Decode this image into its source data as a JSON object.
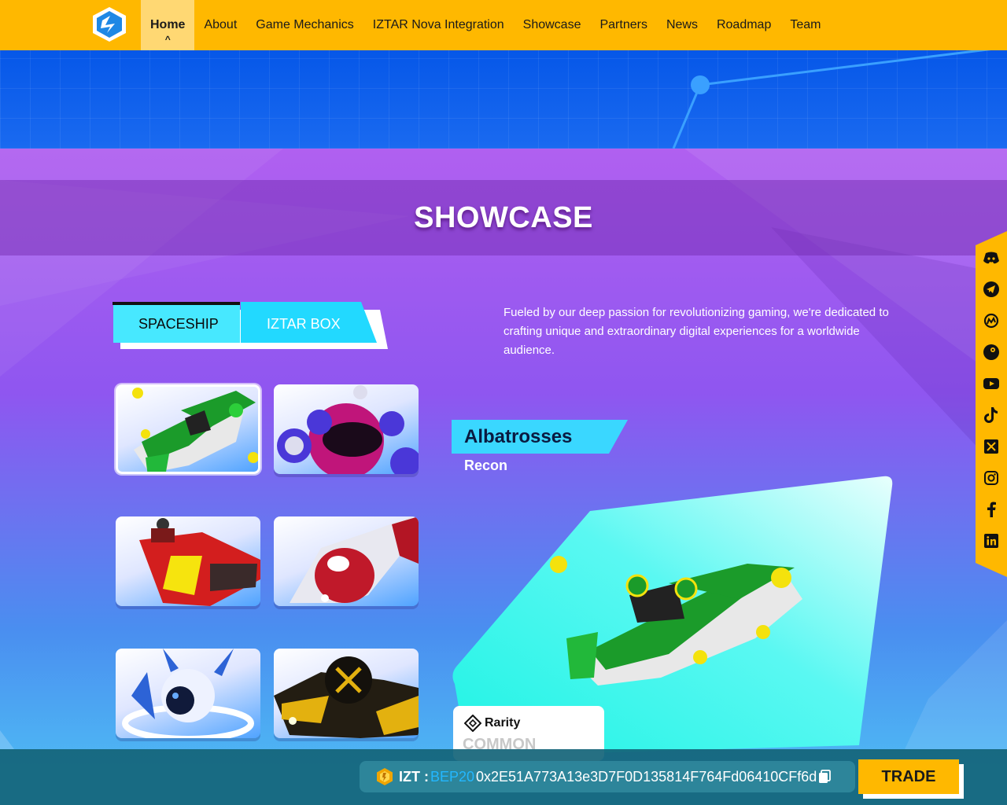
{
  "nav": {
    "logo_icon": "iztar-logo-icon",
    "items": [
      {
        "label": "Home",
        "active": true
      },
      {
        "label": "About"
      },
      {
        "label": "Game Mechanics"
      },
      {
        "label": "IZTAR Nova Integration"
      },
      {
        "label": "Showcase"
      },
      {
        "label": "Partners"
      },
      {
        "label": "News"
      },
      {
        "label": "Roadmap"
      },
      {
        "label": "Team"
      }
    ]
  },
  "page": {
    "title": "SHOWCASE"
  },
  "tabs": [
    {
      "label": "SPACESHIP",
      "active": true
    },
    {
      "label": "IZTAR BOX",
      "active": false
    }
  ],
  "description": "Fueled by our deep passion for revolutionizing gaming, we're dedicated to crafting unique and extraordinary digital experiences for a worldwide audience.",
  "grid": [
    {
      "icon": "green-spaceship-icon",
      "selected": true
    },
    {
      "icon": "pink-pod-spaceship-icon",
      "selected": false
    },
    {
      "icon": "red-yellow-spaceship-icon",
      "selected": false
    },
    {
      "icon": "red-white-spaceship-icon",
      "selected": false
    },
    {
      "icon": "white-orb-spaceship-icon",
      "selected": false
    },
    {
      "icon": "black-gold-spaceship-icon",
      "selected": false
    }
  ],
  "detail": {
    "name": "Albatrosses",
    "class": "Recon",
    "rarity_label": "Rarity",
    "rarity_value": "COMMON",
    "image_icon": "green-spaceship-icon"
  },
  "social": [
    "discord-icon",
    "telegram-icon",
    "coinmarketcap-icon",
    "coingecko-icon",
    "youtube-icon",
    "tiktok-icon",
    "x-icon",
    "instagram-icon",
    "facebook-icon",
    "linkedin-icon"
  ],
  "token": {
    "symbol": "IZT :",
    "chain": "BEP20",
    "address": "0x2E51A773A13e3D7F0D135814F764Fd06410CFf6d",
    "trade_label": "TRADE"
  },
  "colors": {
    "accent": "#ffb800",
    "tab_cyan": "#3ee3ff",
    "chain_blue": "#23b7ff"
  }
}
